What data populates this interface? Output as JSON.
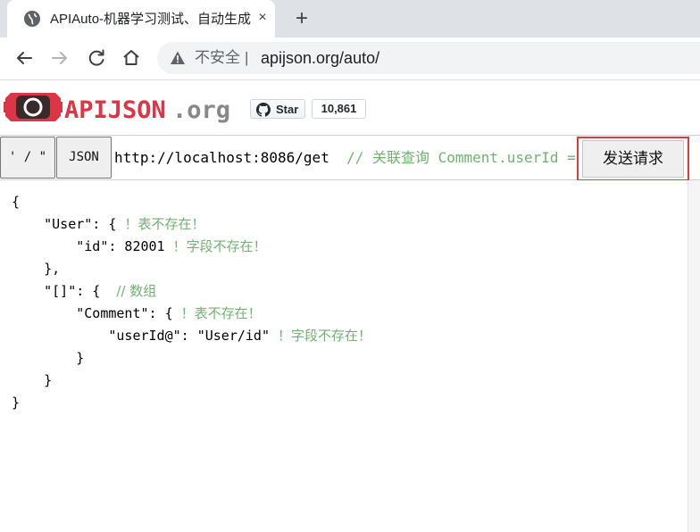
{
  "browser": {
    "tab_title": "APIAuto-机器学习测试、自动生成",
    "tab_close": "×",
    "new_tab": "+",
    "insecure_label": "不安全",
    "separator": "|",
    "url": "apijson.org/auto/"
  },
  "header": {
    "logo_main": "APIJSON",
    "logo_org": ".org",
    "star_label": "Star",
    "star_count": "10,861"
  },
  "request": {
    "slash_button": "' / \"",
    "json_button": "JSON",
    "url": "http://localhost:8086/get",
    "url_comment": "// 关联查询 Comment.userId = User.id",
    "send_button": "发送请求"
  },
  "editor": {
    "lines": [
      {
        "code": "{",
        "comment": ""
      },
      {
        "code": "    \"User\": { ",
        "comment": "！表不存在！"
      },
      {
        "code": "        \"id\": 82001 ",
        "comment": "！字段不存在！"
      },
      {
        "code": "    },",
        "comment": ""
      },
      {
        "code": "    \"[]\": {  ",
        "comment": "// 数组"
      },
      {
        "code": "        \"Comment\": { ",
        "comment": "！表不存在！"
      },
      {
        "code": "            \"userId@\": \"User/id\" ",
        "comment": "！字段不存在！"
      },
      {
        "code": "        }",
        "comment": ""
      },
      {
        "code": "    }",
        "comment": ""
      },
      {
        "code": "}",
        "comment": ""
      }
    ]
  },
  "colors": {
    "brand_red": "#dc3545",
    "comment_green": "#6fb36f",
    "highlight_red": "#e0393e"
  }
}
